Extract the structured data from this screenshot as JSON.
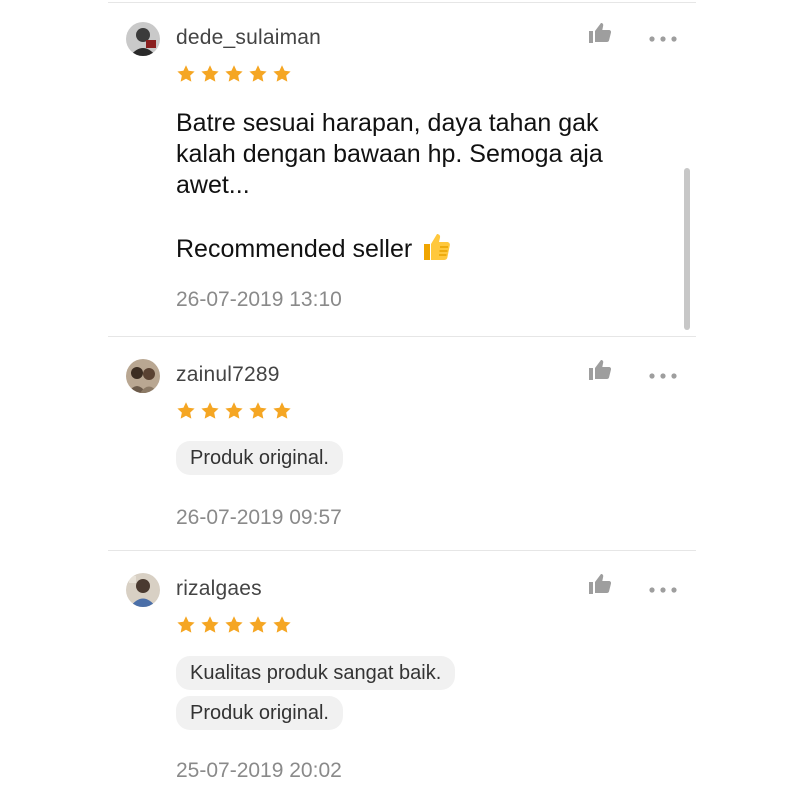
{
  "reviews": [
    {
      "username": "dede_sulaiman",
      "rating": 5,
      "text": "Batre sesuai harapan, daya tahan gak\nkalah dengan bawaan hp. Semoga aja\nawet...",
      "extra_text": "Recommended seller",
      "extra_icon": "thumbs-up-emoji",
      "tags": [],
      "timestamp": "26-07-2019 13:10"
    },
    {
      "username": "zainul7289",
      "rating": 5,
      "tags": [
        "Produk original."
      ],
      "timestamp": "26-07-2019 09:57"
    },
    {
      "username": "rizalgaes",
      "rating": 5,
      "tags": [
        "Kualitas produk sangat baik.",
        "Produk original."
      ],
      "timestamp": "25-07-2019 20:02"
    }
  ],
  "colors": {
    "star": "#F5A623",
    "icon_gray": "#9e9e9e",
    "divider": "#e6e6e6",
    "timestamp": "#8a8a8a",
    "chip_bg": "#f1f1f1"
  },
  "icons": {
    "like": "thumbs-up-icon",
    "more": "more-options-icon",
    "star": "star-icon"
  }
}
